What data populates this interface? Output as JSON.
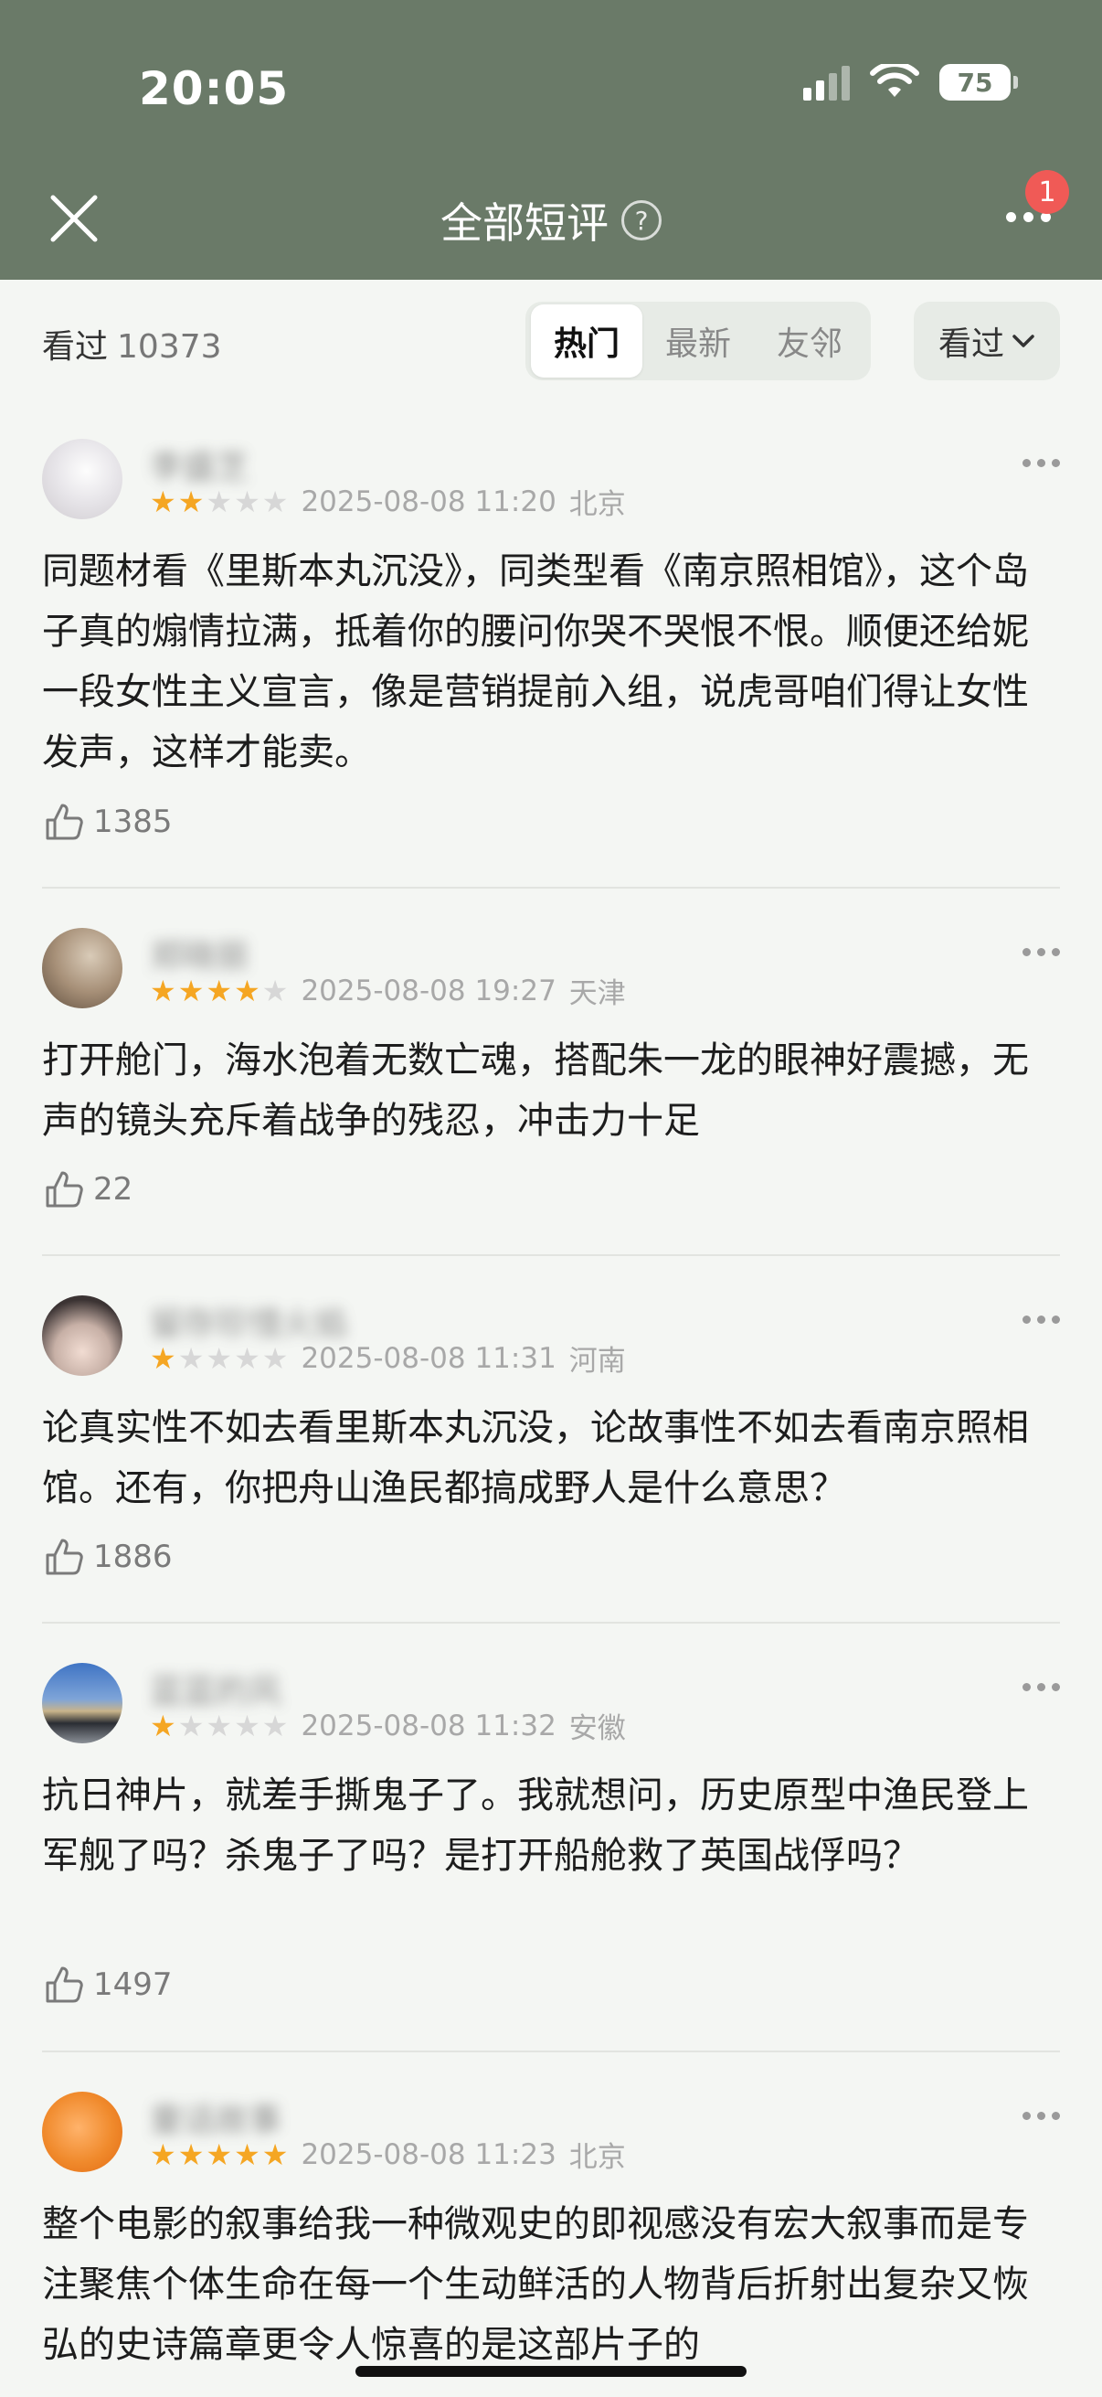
{
  "status": {
    "time": "20:05",
    "battery": "75"
  },
  "nav": {
    "title": "全部短评",
    "help_icon": "?",
    "badge": "1"
  },
  "filter": {
    "seen_label": "看过",
    "seen_count": "10373",
    "tabs": [
      "热门",
      "最新",
      "友邻"
    ],
    "dropdown": "看过"
  },
  "reviews": [
    {
      "username": "李盛芝",
      "rating": 2,
      "date": "2025-08-08 11:20",
      "location": "北京",
      "text": "同题材看《里斯本丸沉没》，同类型看《南京照相馆》，这个岛子真的煽情拉满，抵着你的腰问你哭不哭恨不恨。顺便还给妮一段女性主义宣言，像是营销提前入组，说虎哥咱们得让女性发声，这样才能卖。",
      "likes": "1385"
    },
    {
      "username": "郑晓丽",
      "rating": 4,
      "date": "2025-08-08 19:27",
      "location": "天津",
      "text": "打开舱门，海水泡着无数亡魂，搭配朱一龙的眼神好震撼，无声的镜头充斥着战争的残忍，冲击力十足",
      "likes": "22"
    },
    {
      "username": "留存珍惜火焰",
      "rating": 1,
      "date": "2025-08-08 11:31",
      "location": "河南",
      "text": "论真实性不如去看里斯本丸沉没，论故事性不如去看南京照相馆。还有，你把舟山渔民都搞成野人是什么意思？",
      "likes": "1886"
    },
    {
      "username": "蓝蓝的风",
      "rating": 1,
      "date": "2025-08-08 11:32",
      "location": "安徽",
      "text": "抗日神片，就差手撕鬼子了。我就想问，历史原型中渔民登上军舰了吗？杀鬼子了吗？是打开船舱救了英国战俘吗？",
      "likes": "1497"
    },
    {
      "username": "童话故事",
      "rating": 5,
      "date": "2025-08-08 11:23",
      "location": "北京",
      "text": "整个电影的叙事给我一种微观史的即视感没有宏大叙事而是专注聚焦个体生命在每一个生动鲜活的人物背后折射出复杂又恢弘的史诗篇章更令人惊喜的是这部片子的",
      "likes": ""
    }
  ],
  "colors": {
    "header": "#6a7a68",
    "star": "#f5a623",
    "badge": "#f05a56"
  }
}
